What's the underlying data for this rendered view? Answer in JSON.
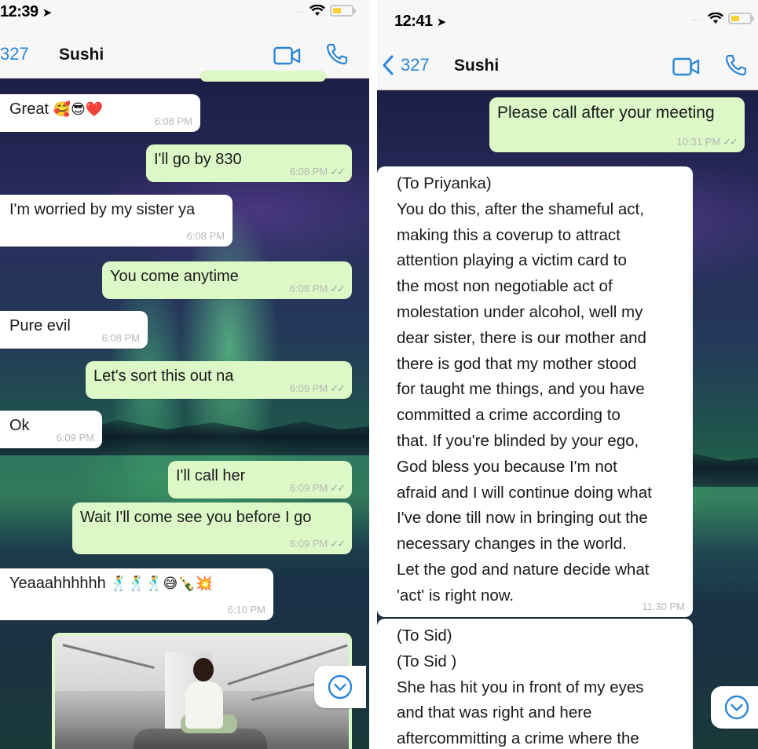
{
  "left": {
    "status": {
      "time": "12:39",
      "signal": "....",
      "location_icon": "location-arrow-icon",
      "wifi_icon": "wifi-icon",
      "battery_icon": "battery-icon"
    },
    "header": {
      "back_count": "327",
      "contact": "Sushi",
      "video_icon": "video-call-icon",
      "phone_icon": "phone-icon"
    },
    "messages": [
      {
        "dir": "in",
        "text": "Great",
        "emoji": "🥰😎❤️",
        "time": "6:08 PM"
      },
      {
        "dir": "out",
        "text": "I'll go by 830",
        "time": "6:08 PM",
        "ticks": "✓✓"
      },
      {
        "dir": "in",
        "text": "I'm worried by my sister ya",
        "time": "6:08 PM"
      },
      {
        "dir": "out",
        "text": "You come anytime",
        "time": "6:08 PM",
        "ticks": "✓✓"
      },
      {
        "dir": "in",
        "text": "Pure evil",
        "time": "6:08 PM"
      },
      {
        "dir": "out",
        "text": "Let's sort this out na",
        "time": "6:09 PM",
        "ticks": "✓✓"
      },
      {
        "dir": "in",
        "text": "Ok",
        "time": "6:09 PM"
      },
      {
        "dir": "out",
        "text": "I'll call her",
        "time": "6:09 PM",
        "ticks": "✓✓"
      },
      {
        "dir": "out",
        "text": "Wait I'll come see you before I go",
        "time": "6:09 PM",
        "ticks": "✓✓"
      },
      {
        "dir": "in",
        "text": "Yeaaahhhhhh",
        "emoji": "🕺🕺🕺😅🍾💥",
        "time": "6:10 PM"
      }
    ],
    "scroll_icon": "chevron-down-circle-icon"
  },
  "right": {
    "status": {
      "time": "12:41",
      "signal": "....",
      "location_icon": "location-arrow-icon",
      "wifi_icon": "wifi-icon",
      "battery_icon": "battery-icon"
    },
    "header": {
      "back_count": "327",
      "contact": "Sushi",
      "video_icon": "video-call-icon",
      "phone_icon": "phone-icon"
    },
    "messages": [
      {
        "dir": "out",
        "text": "Please call after your meeting",
        "time": "10:31 PM",
        "ticks": "✓✓"
      },
      {
        "dir": "in",
        "lines": [
          "(To Priyanka)",
          "You do this, after the shameful act,",
          "making this a coverup to attract",
          "attention playing a victim card to",
          "the most non negotiable act of",
          "molestation under alcohol, well my",
          "dear sister, there is our mother and",
          "there is god that my mother stood",
          "for taught me things, and you have",
          "committed a crime according to",
          "that. If you're blinded by your ego,",
          "God bless you because I'm not",
          "afraid and I will continue doing what",
          "I've done till now in bringing out the",
          "necessary changes in the world.",
          "Let the god and nature decide what",
          "'act' is right now."
        ],
        "time": "11:30 PM"
      },
      {
        "dir": "in",
        "lines": [
          "(To Sid)",
          "(To Sid )",
          "She has hit you in front of my eyes",
          "and that was right and here",
          "aftercommitting a crime where the"
        ]
      }
    ],
    "scroll_icon": "chevron-down-circle-icon"
  }
}
